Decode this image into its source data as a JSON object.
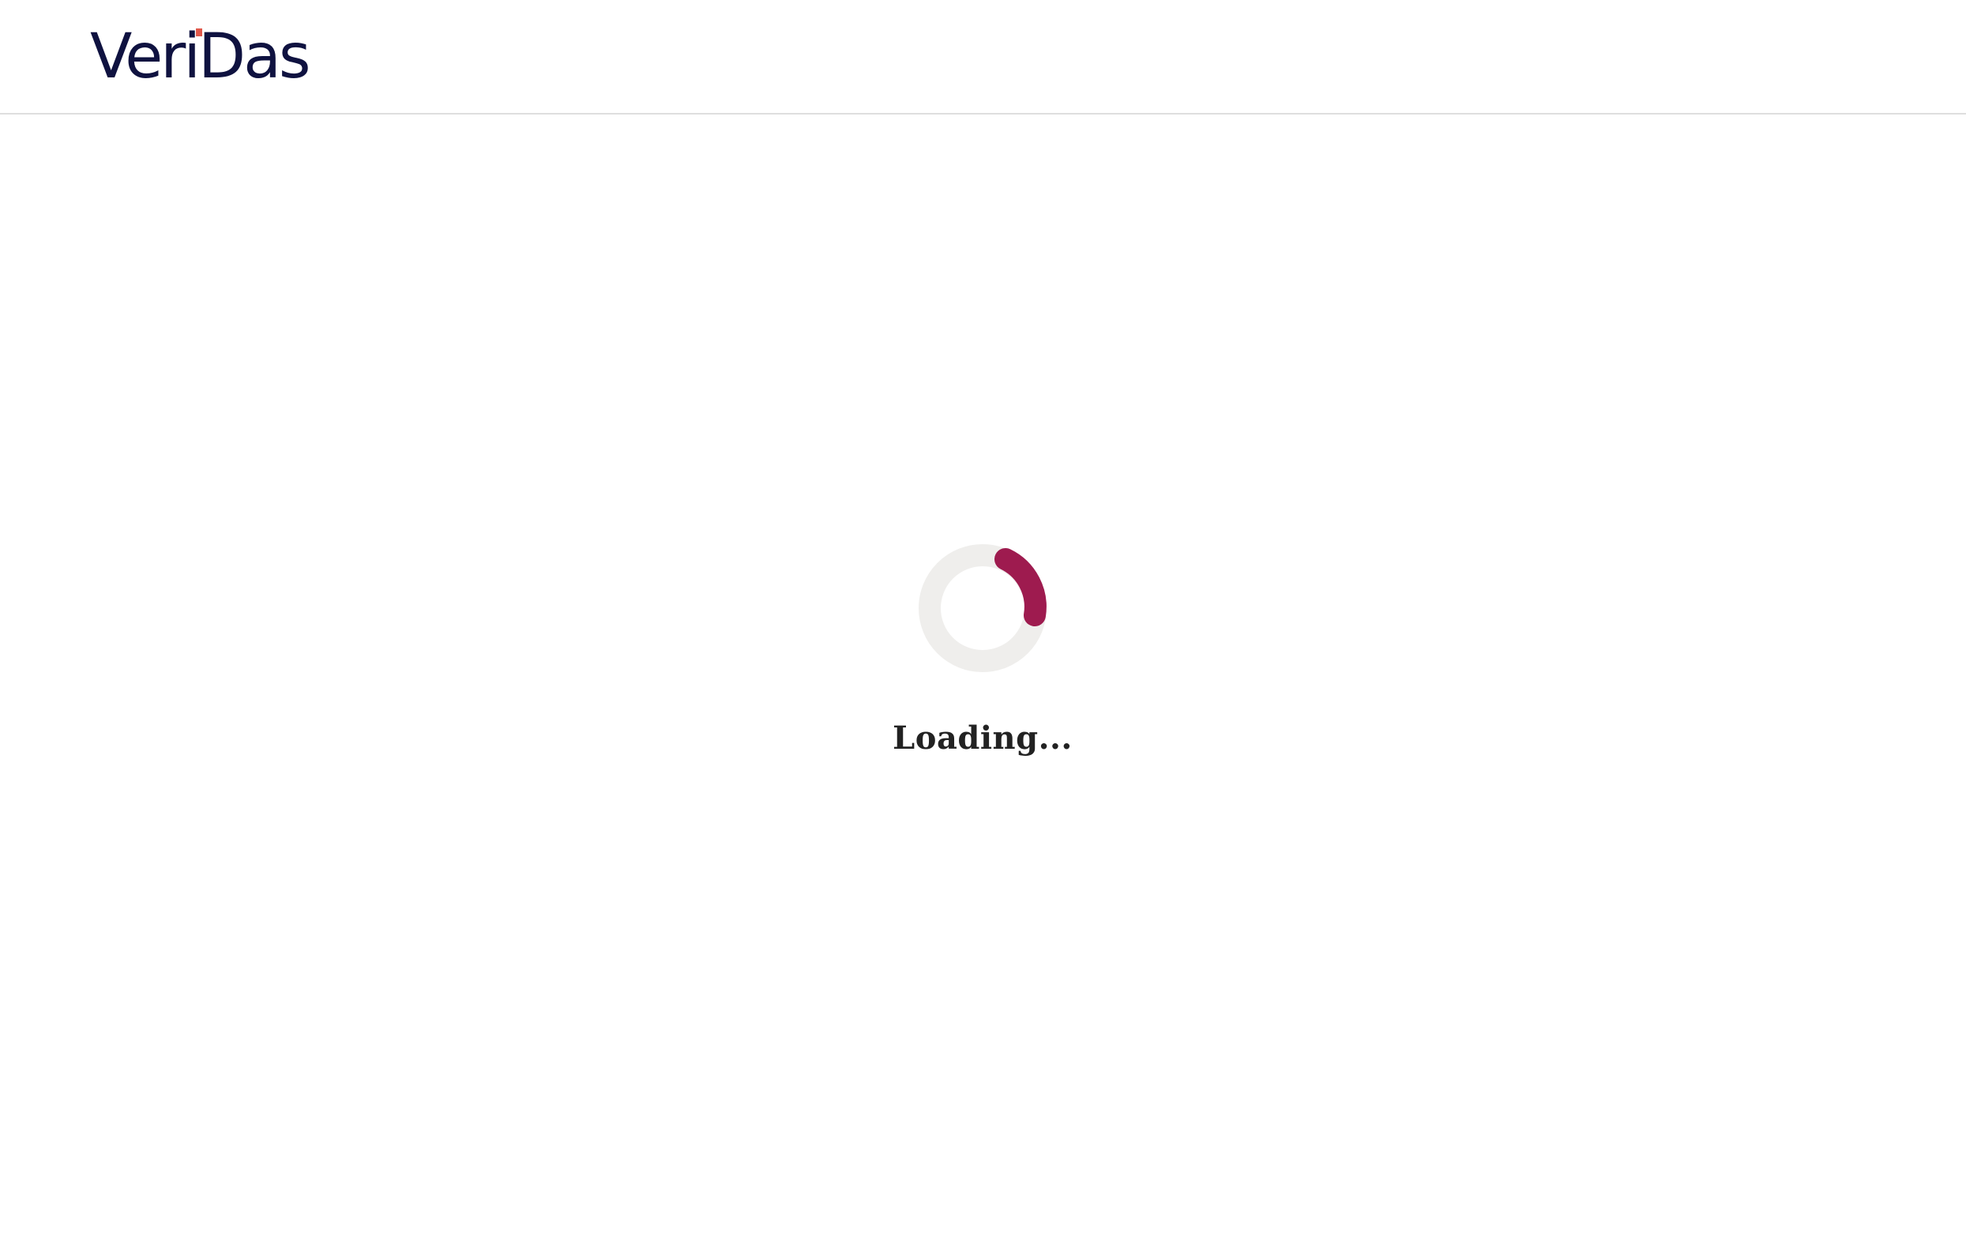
{
  "header": {
    "logo": {
      "name": "veridas-logo",
      "text": "VeriDas",
      "text_color": "#0f1240",
      "accent_color": "#e0594b"
    }
  },
  "main": {
    "spinner": {
      "icon": "loading-spinner-icon",
      "track_color": "#efeeec",
      "arc_color": "#9e1b4f"
    },
    "loading_label": "Loading..."
  }
}
